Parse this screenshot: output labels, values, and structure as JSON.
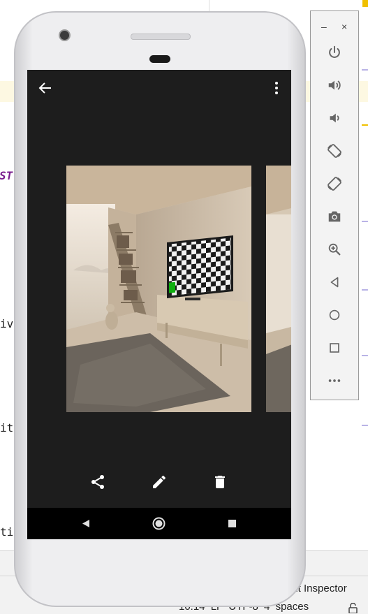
{
  "ide": {
    "code_keyword": "ST",
    "code_lines": [
      "iv",
      "it",
      "ti"
    ],
    "layout_inspector_label": "out Inspector",
    "status": {
      "time": "10:14",
      "line_ending": "LF",
      "encoding": "UTF-8",
      "indent": "4 spaces"
    }
  },
  "emulator_toolbar": {
    "minimize_label": "–",
    "close_label": "×",
    "buttons": [
      "power-icon",
      "volume-up-icon",
      "volume-down-icon",
      "rotate-left-icon",
      "rotate-right-icon",
      "camera-icon",
      "zoom-icon",
      "back-icon",
      "home-icon",
      "overview-icon",
      "more-icon"
    ]
  },
  "phone_app": {
    "top_bar": {
      "back_icon": "arrow-back-icon",
      "menu_icon": "more-vert-icon"
    },
    "photo": {
      "subject": "room-with-tv"
    },
    "actions": [
      "share-icon",
      "edit-icon",
      "delete-icon"
    ]
  },
  "system_nav": [
    "nav-back-icon",
    "nav-home-icon",
    "nav-recents-icon"
  ],
  "colors": {
    "screen_bg": "#1d1d1d",
    "nav_bar_bg": "#000000",
    "ide_highlight": "#fdf8e2",
    "ide_keyword": "#7a1e8e",
    "toolbar_bg": "#f3f3f3",
    "toolbar_icon": "#666666"
  }
}
